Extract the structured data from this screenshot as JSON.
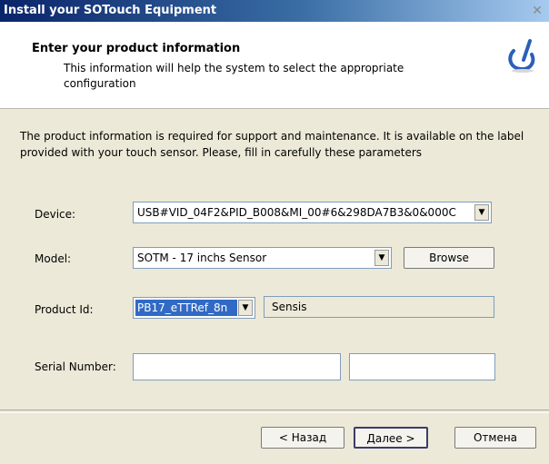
{
  "window": {
    "title": "Install your SOTouch Equipment",
    "close_symbol": "✕"
  },
  "header": {
    "title": "Enter your product information",
    "subtitle": "This information will help the system to select the appropriate configuration",
    "logo_icon": "sotouch-logo-icon"
  },
  "intro": "The product information is required for support and maintenance. It is available on the label provided with your touch sensor. Please, fill in carefully these parameters",
  "form": {
    "device": {
      "label": "Device:",
      "value": "USB#VID_04F2&PID_B008&MI_00#6&298DA7B3&0&000C"
    },
    "model": {
      "label": "Model:",
      "value": "SOTM - 17 inchs Sensor",
      "browse_label": "Browse"
    },
    "product_id": {
      "label": "Product Id:",
      "value": "PB17_eTTRef_8n",
      "vendor": "Sensis"
    },
    "serial_number": {
      "label": "Serial Number:",
      "value_1": "",
      "value_2": ""
    }
  },
  "footer": {
    "back_label": "< Назад",
    "next_label": "Далее >",
    "cancel_label": "Отмена"
  },
  "icons": {
    "dropdown": "▼"
  }
}
